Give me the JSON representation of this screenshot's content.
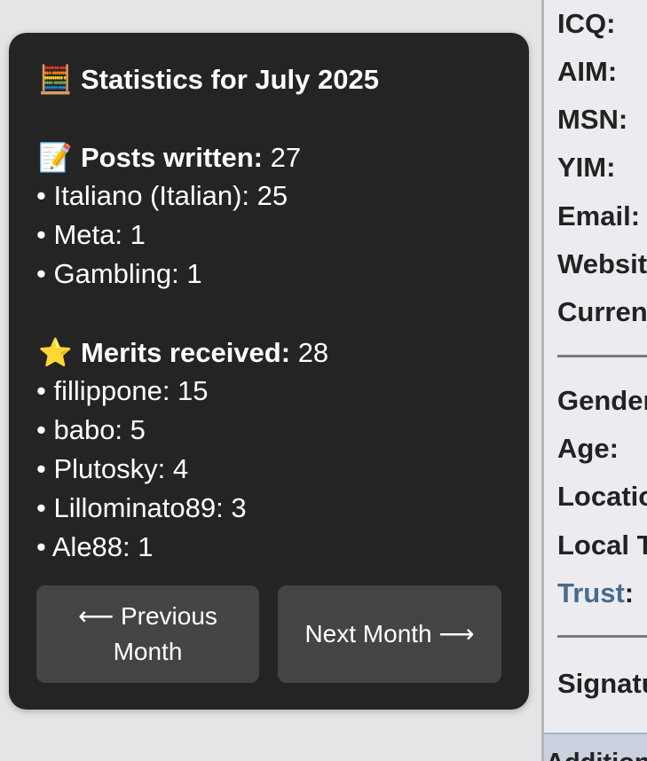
{
  "stats": {
    "title_emoji": "🧮",
    "title": "Statistics for July 2025",
    "posts": {
      "emoji": "📝",
      "label": "Posts written:",
      "value": "27",
      "items": [
        "• Italiano (Italian): 25",
        "• Meta: 1",
        "• Gambling: 1"
      ]
    },
    "merits": {
      "emoji": "⭐",
      "label": "Merits received:",
      "value": "28",
      "items": [
        "• fillippone: 15",
        "• babo: 5",
        "• Plutosky: 4",
        "• Lillominato89: 3",
        "• Ale88: 1"
      ]
    },
    "prev_button": "⟵ Previous Month",
    "next_button": "Next Month ⟶"
  },
  "profile": {
    "group1": [
      "ICQ:",
      "AIM:",
      "MSN:",
      "YIM:",
      "Email:",
      "Website:",
      "Current"
    ],
    "group2": [
      "Gender:",
      "Age:",
      "Location:",
      "Local Time:"
    ],
    "trust_link": "Trust",
    "trust_colon": ":",
    "signature": "Signature:",
    "footer": "Additional"
  },
  "colors": {
    "card_bg": "#242424",
    "button_bg": "#444444",
    "trust_link": "#476c8e"
  }
}
